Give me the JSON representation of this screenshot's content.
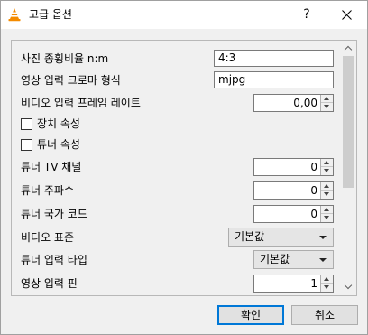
{
  "window": {
    "title": "고급 옵션",
    "help_label": "?",
    "icon": "vlc-cone-icon"
  },
  "fields": {
    "aspect_ratio": {
      "label": "사진 종횡비율 n:m",
      "value": "4:3"
    },
    "chroma": {
      "label": "영상 입력 크로마 형식",
      "value": "mjpg"
    },
    "frame_rate": {
      "label": "비디오 입력 프레임 레이트",
      "value": "0,00"
    },
    "device_props": {
      "label": "장치 속성",
      "checked": false
    },
    "tuner_props": {
      "label": "튜너 속성",
      "checked": false
    },
    "tuner_channel": {
      "label": "튜너 TV 채널",
      "value": "0"
    },
    "tuner_freq": {
      "label": "튜너 주파수",
      "value": "0"
    },
    "tuner_country": {
      "label": "튜너 국가 코드",
      "value": "0"
    },
    "video_standard": {
      "label": "비디오 표준",
      "value": "기본값"
    },
    "tuner_input_type": {
      "label": "튜너 입력 타입",
      "value": "기본값"
    },
    "video_input_pin": {
      "label": "영상 입력 핀",
      "value": "-1"
    }
  },
  "buttons": {
    "ok": "확인",
    "cancel": "취소"
  },
  "colors": {
    "focus_border": "#0078d7",
    "icon_orange": "#f48b00"
  }
}
